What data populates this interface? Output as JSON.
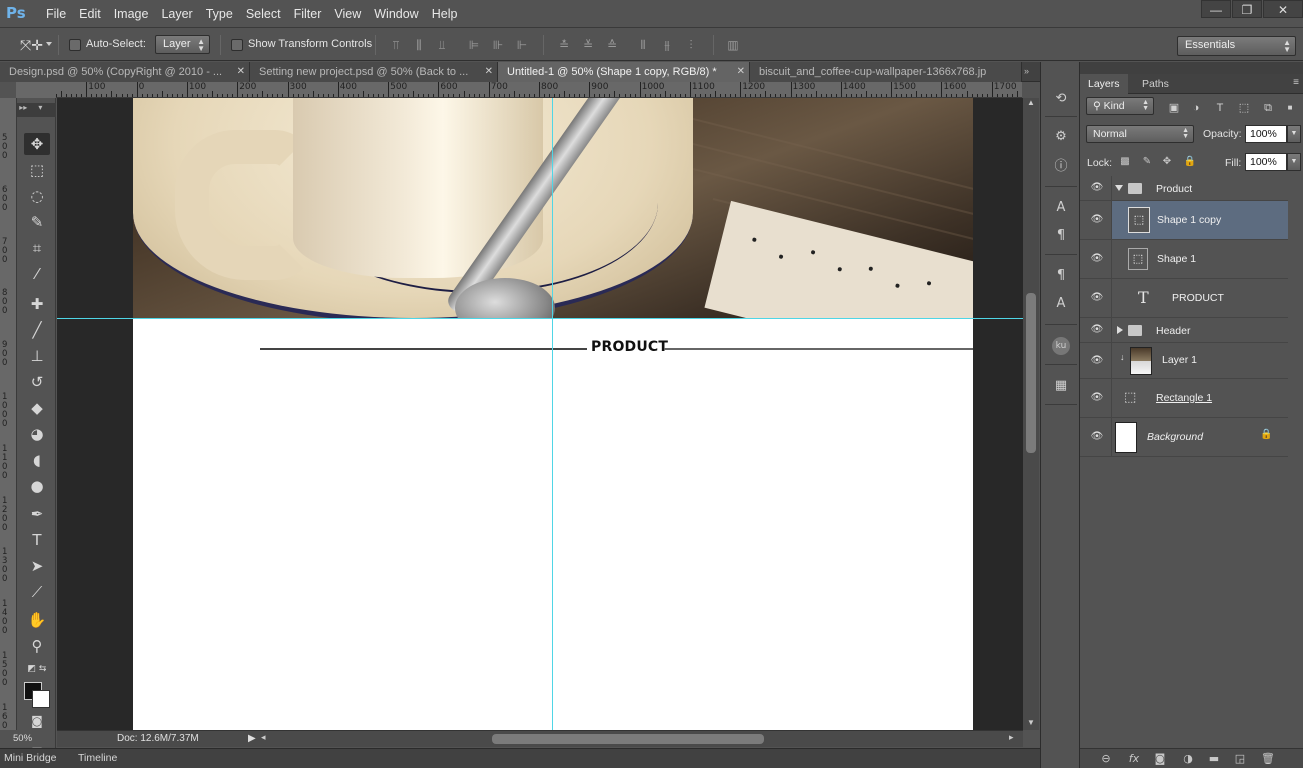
{
  "app": {
    "logo": "Ps",
    "menus": [
      "File",
      "Edit",
      "Image",
      "Layer",
      "Type",
      "Select",
      "Filter",
      "View",
      "Window",
      "Help"
    ],
    "window_controls": {
      "minimize": "—",
      "restore": "❐",
      "close": "✕"
    }
  },
  "options_bar": {
    "auto_select_label": "Auto-Select:",
    "auto_select_target": "Layer",
    "show_transform_label": "Show Transform Controls",
    "workspace": "Essentials"
  },
  "tabs": [
    {
      "label": "Design.psd @ 50% (CopyRight @ 2010 - ...",
      "close": "✕",
      "active": false
    },
    {
      "label": "Setting new project.psd @ 50% (Back to ...",
      "close": "✕",
      "active": false
    },
    {
      "label": "Untitled-1 @ 50% (Shape 1 copy, RGB/8) *",
      "close": "✕",
      "active": true
    },
    {
      "label": "biscuit_and_coffee-cup-wallpaper-1366x768.jp",
      "close": "",
      "active": false
    }
  ],
  "tab_overflow": "»",
  "ruler_top_labels": [
    "200",
    "100",
    "0",
    "100",
    "200",
    "300",
    "400",
    "500",
    "600",
    "700",
    "800",
    "900",
    "1000",
    "1100",
    "1200",
    "1300",
    "1400",
    "1500",
    "1600",
    "1700"
  ],
  "ruler_left_labels": [
    "500",
    "600",
    "700",
    "800",
    "900",
    "1000",
    "1100",
    "1200",
    "1300",
    "1400",
    "1500",
    "1600"
  ],
  "document": {
    "heading": "PRODUCT"
  },
  "status": {
    "zoom": "50%",
    "doc_size": "Doc: 12.6M/7.37M",
    "arrow": "▶"
  },
  "bottom_tabs": {
    "mini_bridge": "Mini Bridge",
    "timeline": "Timeline"
  },
  "layers_panel": {
    "tabs": [
      "Layers",
      "Paths"
    ],
    "filter_kind": "Kind",
    "blend_mode": "Normal",
    "opacity_label": "Opacity:",
    "opacity_value": "100%",
    "lock_label": "Lock:",
    "fill_label": "Fill:",
    "fill_value": "100%",
    "layers": [
      {
        "name": "Product",
        "type": "group",
        "expanded": true
      },
      {
        "name": "Shape 1 copy",
        "type": "shape",
        "selected": true
      },
      {
        "name": "Shape 1",
        "type": "shape"
      },
      {
        "name": "PRODUCT",
        "type": "text"
      },
      {
        "name": "Header",
        "type": "group",
        "expanded": false
      },
      {
        "name": "Layer 1",
        "type": "image"
      },
      {
        "name": "Rectangle 1",
        "type": "shape"
      },
      {
        "name": "Background",
        "type": "background"
      }
    ]
  },
  "icons": {
    "eye": "👁",
    "lock": "🔒"
  }
}
